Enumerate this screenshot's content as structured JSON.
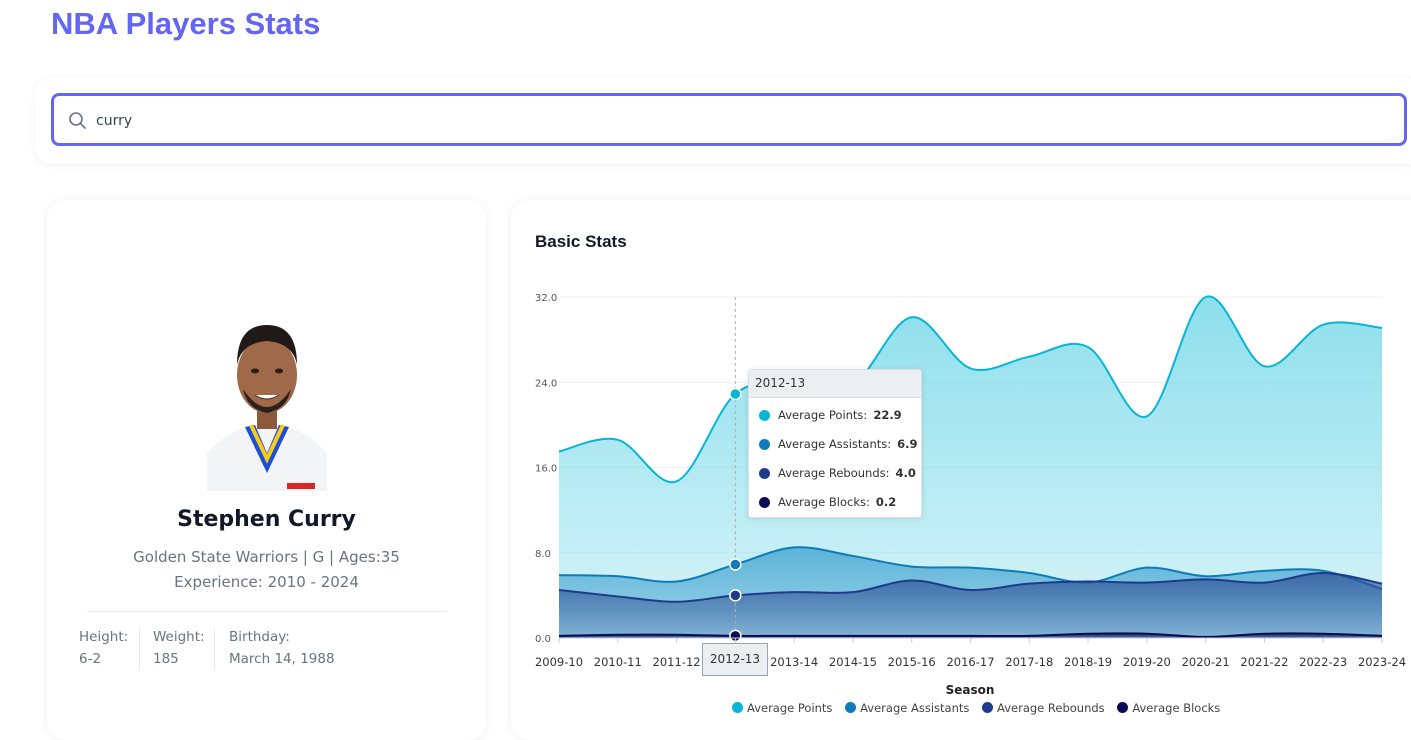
{
  "header": {
    "title": "NBA Players Stats"
  },
  "search": {
    "value": "curry"
  },
  "player": {
    "name": "Stephen Curry",
    "team_line": "Golden State Warriors | G | Ages:35",
    "experience": "Experience: 2010 - 2024",
    "height_label": "Height:",
    "height_value": "6-2",
    "weight_label": "Weight:",
    "weight_value": "185",
    "birthday_label": "Birthday:",
    "birthday_value": "March 14, 1988"
  },
  "chart_data": {
    "type": "area",
    "title": "Basic Stats",
    "xlabel": "Season",
    "ylabel": "",
    "ylim": [
      0,
      32
    ],
    "yticks": [
      "0.0",
      "8.0",
      "16.0",
      "24.0",
      "32.0"
    ],
    "categories": [
      "2009-10",
      "2010-11",
      "2011-12",
      "2012-13",
      "2013-14",
      "2014-15",
      "2015-16",
      "2016-17",
      "2017-18",
      "2018-19",
      "2019-20",
      "2020-21",
      "2021-22",
      "2022-23",
      "2023-24"
    ],
    "series": [
      {
        "name": "Average Points",
        "color": "#06b6d4",
        "values": [
          17.5,
          18.6,
          14.7,
          22.9,
          24.0,
          23.8,
          30.1,
          25.3,
          26.4,
          27.3,
          20.8,
          32.0,
          25.5,
          29.4,
          29.1
        ]
      },
      {
        "name": "Average Assistants",
        "color": "#0e7bb8",
        "values": [
          5.9,
          5.8,
          5.3,
          6.9,
          8.5,
          7.7,
          6.7,
          6.6,
          6.1,
          5.2,
          6.6,
          5.8,
          6.3,
          6.3,
          4.6
        ]
      },
      {
        "name": "Average Rebounds",
        "color": "#1e3a8a",
        "values": [
          4.5,
          3.9,
          3.4,
          4.0,
          4.3,
          4.3,
          5.4,
          4.5,
          5.1,
          5.3,
          5.2,
          5.5,
          5.2,
          6.1,
          5.1
        ]
      },
      {
        "name": "Average Blocks",
        "color": "#0b0b55",
        "values": [
          0.2,
          0.3,
          0.3,
          0.2,
          0.2,
          0.2,
          0.2,
          0.2,
          0.2,
          0.4,
          0.4,
          0.1,
          0.4,
          0.4,
          0.2
        ]
      }
    ],
    "grid": true,
    "legend": "bottom",
    "tooltip": {
      "category": "2012-13",
      "rows": [
        {
          "label": "Average Points:",
          "value": "22.9"
        },
        {
          "label": "Average Assistants:",
          "value": "6.9"
        },
        {
          "label": "Average Rebounds:",
          "value": "4.0"
        },
        {
          "label": "Average Blocks:",
          "value": "0.2"
        }
      ]
    }
  }
}
